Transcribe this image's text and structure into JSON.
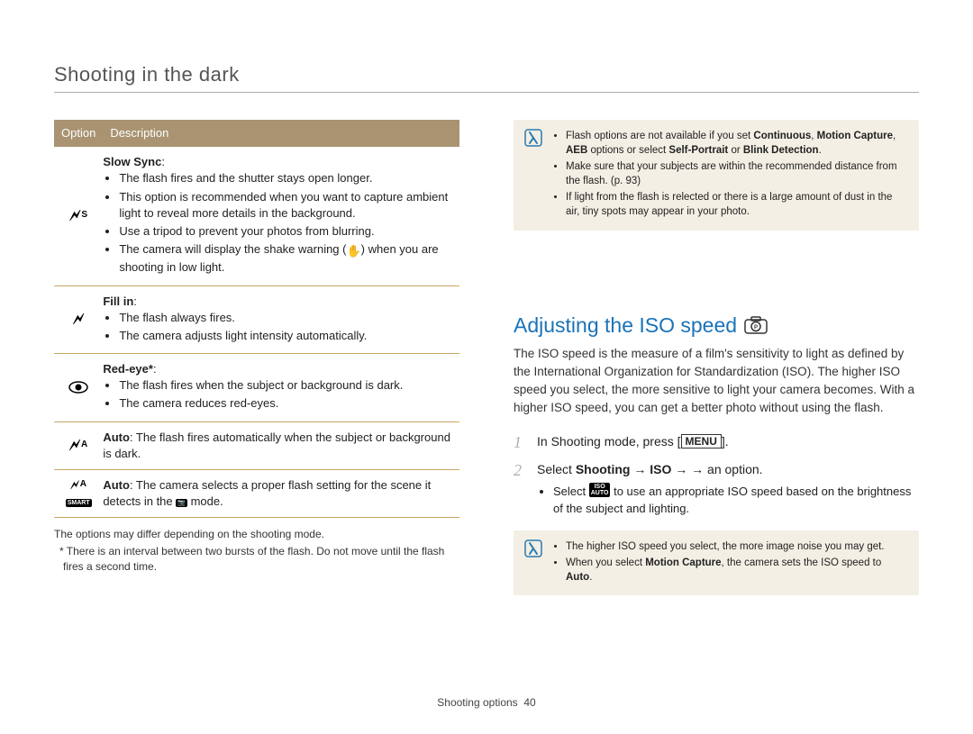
{
  "header": "Shooting in the dark",
  "table": {
    "head_option": "Option",
    "head_desc": "Description",
    "rows": [
      {
        "icon": "flash-s",
        "title": "Slow Sync",
        "title_suffix": ":",
        "bullets": [
          "The flash fires and the shutter stays open longer.",
          "This option is recommended when you want to capture ambient light to reveal more details in the background.",
          "Use a tripod to prevent your photos from blurring.",
          "The camera will display the shake warning (hand) when you are shooting in low light."
        ]
      },
      {
        "icon": "flash-fill",
        "title": "Fill in",
        "title_suffix": ":",
        "bullets": [
          "The flash always fires.",
          "The camera adjusts light intensity automatically."
        ]
      },
      {
        "icon": "eye",
        "title": "Red-eye*",
        "title_suffix": ":",
        "bullets": [
          "The flash fires when the subject or background is dark.",
          "The camera reduces red-eyes."
        ]
      },
      {
        "icon": "flash-a",
        "inline_title": "Auto",
        "inline_text": ": The flash fires automatically when the subject or background is dark."
      },
      {
        "icon": "flash-smart",
        "inline_title": "Auto",
        "inline_text_pre": ": The camera selects a proper flash setting for the scene it detects in the ",
        "inline_text_post": " mode."
      }
    ]
  },
  "footnotes": {
    "line1": "The options may differ depending on the shooting mode.",
    "line2": "* There is an interval between two bursts of the flash. Do not move until the flash fires a second time."
  },
  "note1": {
    "bullets": [
      {
        "pre": "Flash options are not available if you set ",
        "b1": "Continuous",
        "mid1": ", ",
        "b2": "Motion Capture",
        "mid2": ", ",
        "b3": "AEB",
        "mid3": " options or select ",
        "b4": "Self-Portrait",
        "mid4": " or ",
        "b5": "Blink Detection",
        "post": "."
      },
      {
        "text": "Make sure that your subjects are within the recommended distance from the flash. (p. 93)"
      },
      {
        "text": "If light from the flash is relected or there is a large amount of dust in the air, tiny spots may appear in your photo."
      }
    ]
  },
  "heading2": "Adjusting the ISO speed",
  "iso_paragraph": "The ISO speed is the measure of a film's sensitivity to light as defined by the International Organization for Standardization (ISO). The higher ISO speed you select, the more sensitive to light your camera becomes. With a higher ISO speed, you can get a better photo without using the flash.",
  "steps": {
    "s1_pre": "In Shooting mode, press [",
    "s1_menu": "MENU",
    "s1_post": "].",
    "s2_pre": "Select ",
    "s2_b1": "Shooting",
    "s2_arrow": " → ",
    "s2_b2": "ISO",
    "s2_post": " → an option.",
    "s2_sub_pre": "Select ",
    "s2_sub_post": " to use an appropriate ISO speed based on the brightness of the subject and lighting."
  },
  "note2": {
    "b1": {
      "text": "The higher ISO speed you select, the more image noise you may get."
    },
    "b2": {
      "pre": "When you select ",
      "bold": "Motion Capture",
      "mid": ", the camera sets the ISO speed to ",
      "bold2": "Auto",
      "post": "."
    }
  },
  "footer": {
    "label": "Shooting options",
    "page": "40"
  },
  "icons": {
    "iso_auto": "ISO\nAUTO",
    "smart": "SMART"
  }
}
